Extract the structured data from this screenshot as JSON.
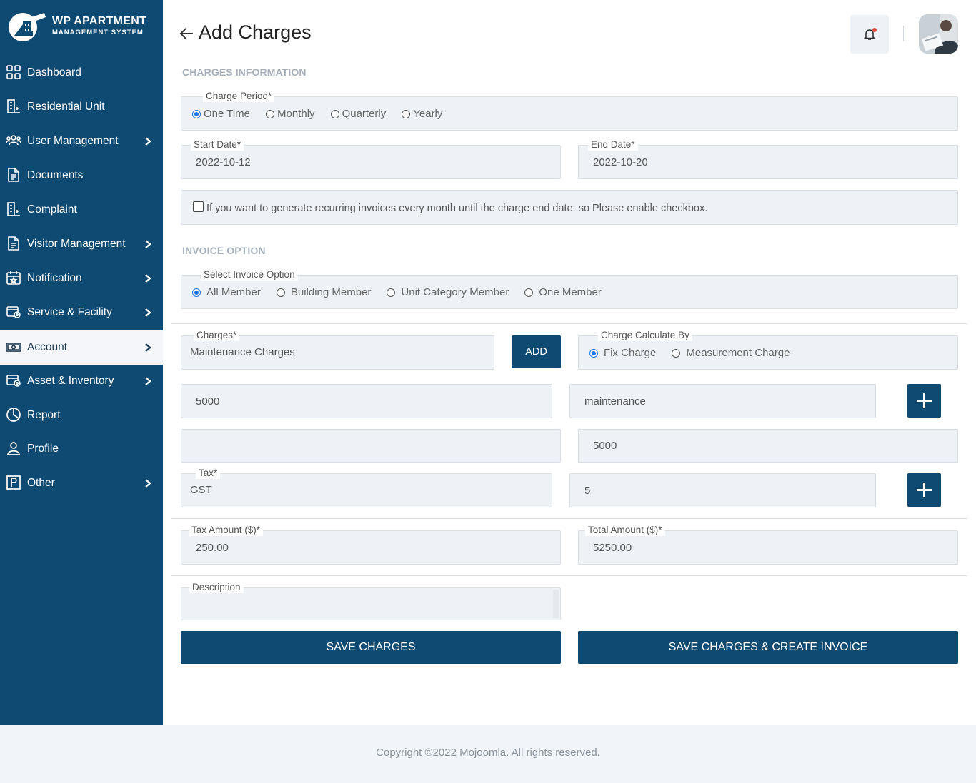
{
  "brand": {
    "title": "WP APARTMENT",
    "subtitle": "MANAGEMENT SYSTEM"
  },
  "sidebar": {
    "items": [
      {
        "label": "Dashboard",
        "icon": "grid-icon",
        "has_submenu": false
      },
      {
        "label": "Residential Unit",
        "icon": "building-icon",
        "has_submenu": false
      },
      {
        "label": "User Management",
        "icon": "users-icon",
        "has_submenu": true
      },
      {
        "label": "Documents",
        "icon": "document-icon",
        "has_submenu": false
      },
      {
        "label": "Complaint",
        "icon": "building-icon",
        "has_submenu": false
      },
      {
        "label": "Visitor Management",
        "icon": "document-icon",
        "has_submenu": true
      },
      {
        "label": "Notification",
        "icon": "calendar-star-icon",
        "has_submenu": true
      },
      {
        "label": "Service & Facility",
        "icon": "service-icon",
        "has_submenu": true
      },
      {
        "label": "Account",
        "icon": "cash-icon",
        "has_submenu": true,
        "active": true
      },
      {
        "label": "Asset & Inventory",
        "icon": "service-icon",
        "has_submenu": true
      },
      {
        "label": "Report",
        "icon": "pie-chart-icon",
        "has_submenu": false
      },
      {
        "label": "Profile",
        "icon": "user-icon",
        "has_submenu": false
      },
      {
        "label": "Other",
        "icon": "parking-icon",
        "has_submenu": true
      }
    ]
  },
  "header": {
    "title": "Add Charges",
    "back_icon": "arrow-left-icon",
    "bell_icon": "bell-icon"
  },
  "charges_info": {
    "section_title": "CHARGES INFORMATION",
    "period_legend": "Charge Period*",
    "periods": [
      "One Time",
      "Monthly",
      "Quarterly",
      "Yearly"
    ],
    "selected_period": "One Time",
    "start_date_legend": "Start Date*",
    "start_date": "2022-10-12",
    "end_date_legend": "End Date*",
    "end_date": "2022-10-20",
    "recurring_text": "If you want to generate recurring invoices every month until the charge end date. so Please enable checkbox.",
    "recurring_checked": false
  },
  "invoice_option": {
    "section_title": "INVOICE OPTION",
    "legend": "Select Invoice Option",
    "options": [
      "All Member",
      "Building Member",
      "Unit Category Member",
      "One Member"
    ],
    "selected": "All Member"
  },
  "charges": {
    "charges_legend": "Charges*",
    "charges_value": "Maintenance Charges",
    "add_label": "ADD",
    "calc_legend": "Charge Calculate By",
    "calc_options": [
      "Fix Charge",
      "Measurement Charge"
    ],
    "calc_selected": "Fix Charge",
    "amount_value": "5000",
    "amount_label_value": "maintenance",
    "blank_value": "",
    "amount_total_value": "5000",
    "tax_legend": "Tax*",
    "tax_value": "GST",
    "tax_rate_value": "5",
    "tax_amount_legend": "Tax Amount ($)*",
    "tax_amount": "250.00",
    "total_amount_legend": "Total Amount ($)*",
    "total_amount": "5250.00",
    "description_legend": "Description",
    "description_value": ""
  },
  "actions": {
    "save_label": "SAVE CHARGES",
    "save_invoice_label": "SAVE CHARGES & CREATE INVOICE"
  },
  "footer": {
    "copyright": "Copyright ©2022 Mojoomla. All rights reserved."
  },
  "colors": {
    "sidebar_bg": "#0f4a73",
    "field_bg": "#eef1f5",
    "radio_selected": "#1a73e8"
  }
}
